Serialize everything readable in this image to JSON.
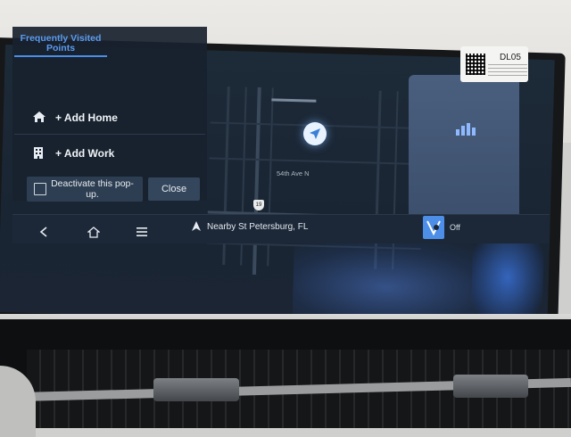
{
  "panel": {
    "title": "Frequently Visited Points",
    "items": [
      {
        "icon": "home-icon",
        "label": "+ Add Home"
      },
      {
        "icon": "work-building-icon",
        "label": "+ Add Work"
      }
    ]
  },
  "popup": {
    "deactivate_label": "Deactivate this pop-up.",
    "close_label": "Close"
  },
  "map": {
    "street_label": "54th Ave N",
    "route_shield": "19"
  },
  "bottom_bar": {
    "back_icon": "back-chevron-icon",
    "home_icon": "home-outline-icon",
    "menu_icon": "menu-lines-icon",
    "nearby_icon": "navigation-arrow-icon",
    "nearby_text": "Nearby St Petersburg, FL",
    "connectivity_status": "Off"
  },
  "sticker": {
    "code": "DL05"
  },
  "colors": {
    "accent": "#4a8ee6",
    "panel_bg": "#18222f",
    "button_bg": "#2e3e52"
  }
}
